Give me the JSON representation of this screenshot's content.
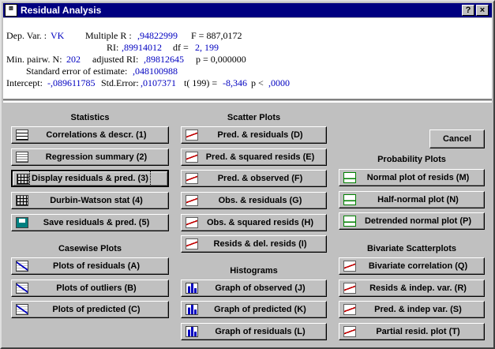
{
  "window": {
    "title": "Residual Analysis",
    "help_label": "?",
    "close_label": "×"
  },
  "results": {
    "dep_var_label": "Dep. Var. :",
    "dep_var_value": "VK",
    "multiple_r_label": "Multiple R :",
    "multiple_r_value": ",94822999",
    "f_label": "F = 887,0172",
    "r2_label": "RI:",
    "r2_value": ",89914012",
    "df_label": "df =",
    "df_value": "2, 199",
    "min_n_label": "Min. pairw. N:",
    "min_n_value": "202",
    "adj_r2_label": "adjusted RI:",
    "adj_r2_value": ",89812645",
    "p_label": "p = 0,000000",
    "std_err_est_label": "Standard error of estimate:",
    "std_err_est_value": ",048100988",
    "intercept_label": "Intercept:",
    "intercept_value": "-,089611785",
    "std_error_label": "Std.Error:",
    "std_error_value": ",0107371",
    "t_label": "t(  199) =",
    "t_value": "-8,346",
    "p2_label": "p <",
    "p2_value": ",0000"
  },
  "groups": {
    "statistics": "Statistics",
    "casewise": "Casewise Plots",
    "scatter": "Scatter Plots",
    "histograms": "Histograms",
    "probability": "Probability Plots",
    "bivariate": "Bivariate Scatterplots"
  },
  "buttons": {
    "correlations": "Correlations & descr. (1)",
    "regression_summary": "Regression summary (2)",
    "display_residuals": "Display residuals & pred. (3)",
    "durbin_watson": "Durbin-Watson stat (4)",
    "save_residuals": "Save residuals & pred. (5)",
    "plots_residuals": "Plots of residuals (A)",
    "plots_outliers": "Plots of outliers (B)",
    "plots_predicted": "Plots of predicted (C)",
    "pred_residuals": "Pred. & residuals (D)",
    "pred_sq_resids": "Pred. & squared resids (E)",
    "pred_observed": "Pred. & observed (F)",
    "obs_residuals": "Obs. & residuals (G)",
    "obs_sq_resids": "Obs. & squared resids (H)",
    "resids_del_resids": "Resids & del. resids (I)",
    "graph_observed": "Graph of observed (J)",
    "graph_predicted": "Graph of predicted (K)",
    "graph_residuals": "Graph of residuals (L)",
    "cancel": "Cancel",
    "normal_plot": "Normal plot of resids (M)",
    "half_normal": "Half-normal plot (N)",
    "detrended_normal": "Detrended normal plot (P)",
    "bivariate_corr": "Bivariate correlation (Q)",
    "resids_indep": "Resids & indep. var. (R)",
    "pred_indep": "Pred. & indep var. (S)",
    "partial_resid": "Partial resid. plot (T)"
  },
  "colors": {
    "titlebar": "#000080",
    "value_text": "#0000c0",
    "face": "#c0c0c0"
  },
  "icons": {
    "title": "stat-app-icon",
    "statistics": [
      "table-icon",
      "summary-icon",
      "grid-icon",
      "grid-icon",
      "save-disk-icon"
    ],
    "casewise": "line-plot-icon",
    "scatter": "scatter-plot-icon",
    "histograms": "histogram-icon",
    "probability": "probability-plot-icon",
    "bivariate": "scatter-plot-icon"
  }
}
